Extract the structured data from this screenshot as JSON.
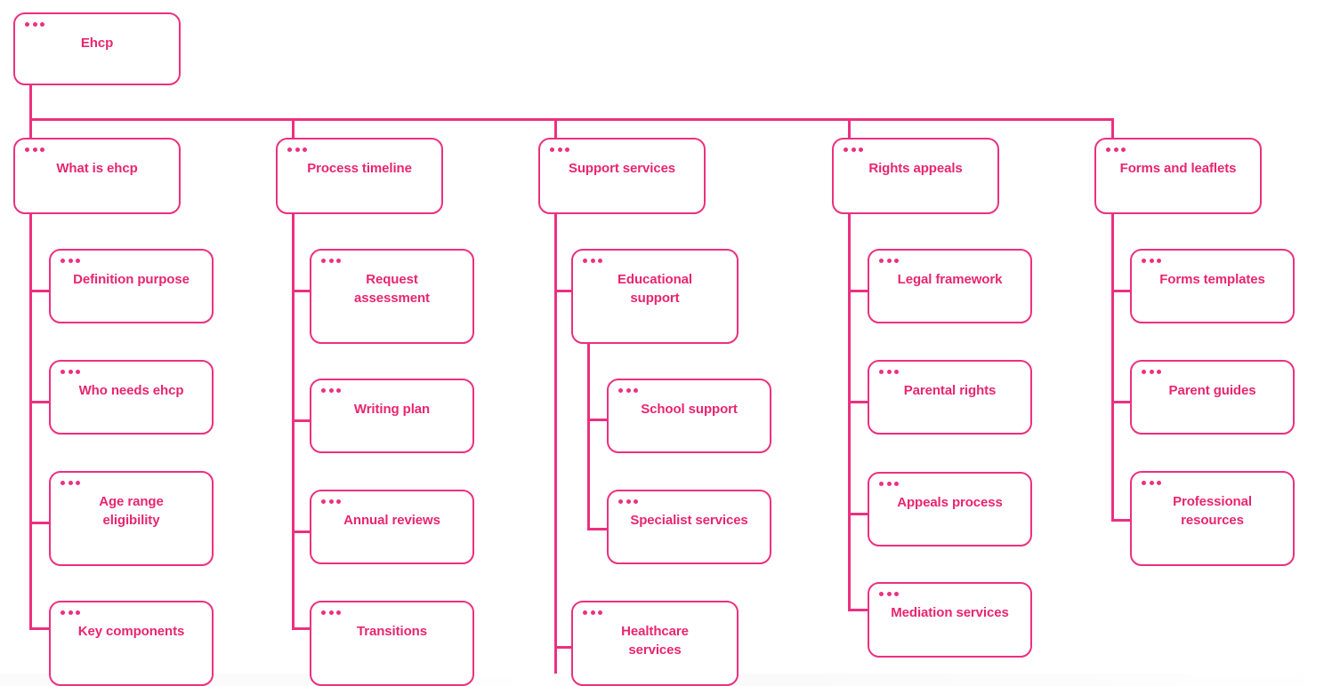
{
  "theme": {
    "accent": "#ec3080",
    "text": "#e8266f",
    "background": "#ffffff"
  },
  "diagram": {
    "type": "sitemap-tree",
    "icon": "three-dots-icon",
    "root": {
      "label": "Ehcp"
    },
    "branches": [
      {
        "label": "What is ehcp",
        "children": [
          {
            "label": "Definition purpose"
          },
          {
            "label": "Who needs ehcp"
          },
          {
            "label": "Age range\neligibility"
          },
          {
            "label": "Key components"
          }
        ]
      },
      {
        "label": "Process timeline",
        "children": [
          {
            "label": "Request\nassessment"
          },
          {
            "label": "Writing plan"
          },
          {
            "label": "Annual reviews"
          },
          {
            "label": "Transitions"
          }
        ]
      },
      {
        "label": "Support services",
        "children": [
          {
            "label": "Educational\nsupport",
            "children": [
              {
                "label": "School support"
              },
              {
                "label": "Specialist services"
              }
            ]
          },
          {
            "label": "Healthcare\nservices"
          }
        ]
      },
      {
        "label": "Rights appeals",
        "children": [
          {
            "label": "Legal framework"
          },
          {
            "label": "Parental rights"
          },
          {
            "label": "Appeals process"
          },
          {
            "label": "Mediation services"
          }
        ]
      },
      {
        "label": "Forms and leaflets",
        "children": [
          {
            "label": "Forms templates"
          },
          {
            "label": "Parent guides"
          },
          {
            "label": "Professional\nresources"
          }
        ]
      }
    ]
  }
}
